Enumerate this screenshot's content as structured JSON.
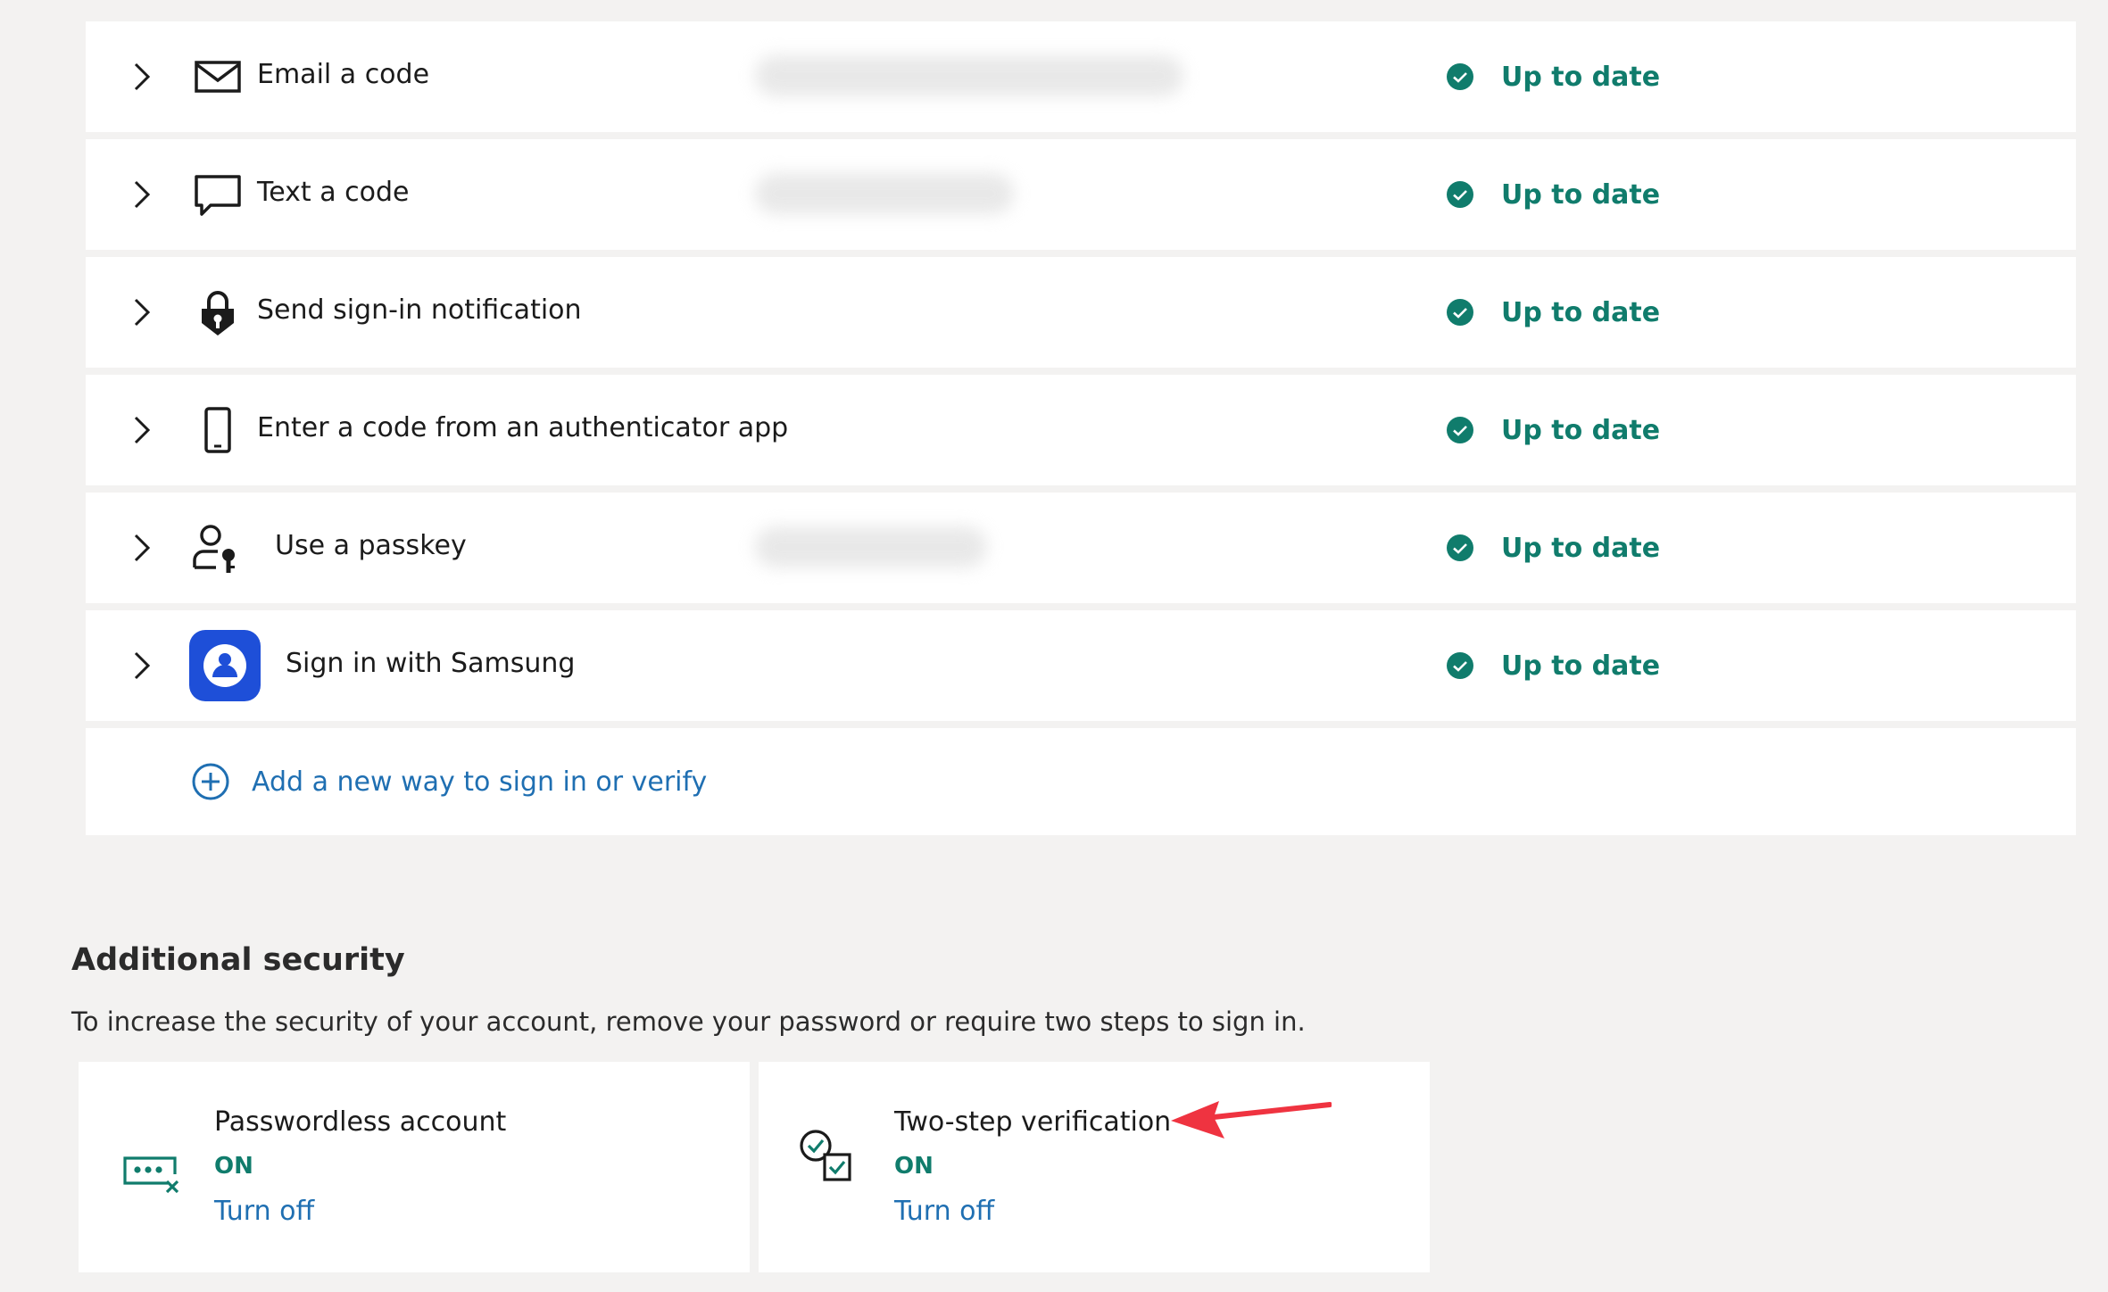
{
  "methods": [
    {
      "label": "Email a code",
      "icon": "envelope-icon",
      "status": "Up to date"
    },
    {
      "label": "Text a code",
      "icon": "chat-bubble-icon",
      "status": "Up to date"
    },
    {
      "label": "Send sign-in notification",
      "icon": "lock-icon",
      "status": "Up to date"
    },
    {
      "label": "Enter a code from an authenticator app",
      "icon": "phone-icon",
      "status": "Up to date"
    },
    {
      "label": "Use a passkey",
      "icon": "person-key-icon",
      "status": "Up to date"
    },
    {
      "label": "Sign in with Samsung",
      "icon": "samsung-icon",
      "status": "Up to date"
    }
  ],
  "add_method": {
    "label": "Add a new way to sign in or verify"
  },
  "additional_security": {
    "title": "Additional security",
    "description": "To increase the security of your account, remove your password or require two steps to sign in.",
    "cards": [
      {
        "title": "Passwordless account",
        "state": "ON",
        "action": "Turn off",
        "icon": "password-dots-icon"
      },
      {
        "title": "Two-step verification",
        "state": "ON",
        "action": "Turn off",
        "icon": "two-step-check-icon"
      }
    ]
  },
  "colors": {
    "accent_green": "#107c6c",
    "link_blue": "#1f6fb2",
    "samsung_blue": "#1e4fd8",
    "annotation_red": "#ef3340"
  }
}
